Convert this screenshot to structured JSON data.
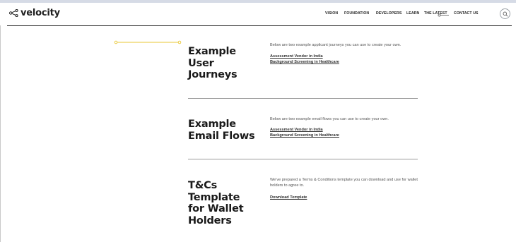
{
  "header": {
    "logo_text": "velocity",
    "logo_icon": "share-nodes-icon",
    "nav": [
      {
        "label": "VISION"
      },
      {
        "label": "FOUNDATION"
      },
      {
        "label": "DEVELOPERS"
      },
      {
        "label": "LEARN"
      },
      {
        "label": "THE LATEST"
      },
      {
        "label": "CONTACT US"
      }
    ],
    "search_icon": "search-icon"
  },
  "colors": {
    "accent": "#e8c733",
    "text": "#1a1a1a",
    "divider": "#9a9a9a",
    "top_strip": "#d6dbe6"
  },
  "sections": [
    {
      "title_lines": [
        "Example",
        "User",
        "Journeys"
      ],
      "description": "Below are two example applicant journeys you can use to create your own.",
      "links": [
        "Assessment Vendor in India",
        "Background Screening in Healthcare"
      ]
    },
    {
      "title_lines": [
        "Example",
        "Email Flows"
      ],
      "description": "Below are two example email flows you can use to create your own.",
      "links": [
        "Assessment Vendor in India",
        "Background Screening in Healthcare"
      ]
    },
    {
      "title_lines": [
        "T&Cs",
        "Template",
        "for Wallet",
        "Holders"
      ],
      "description": "We've prepared a Terms & Conditions template you can download and use for wallet holders to agree to.",
      "links": [
        "Download Template"
      ]
    }
  ]
}
